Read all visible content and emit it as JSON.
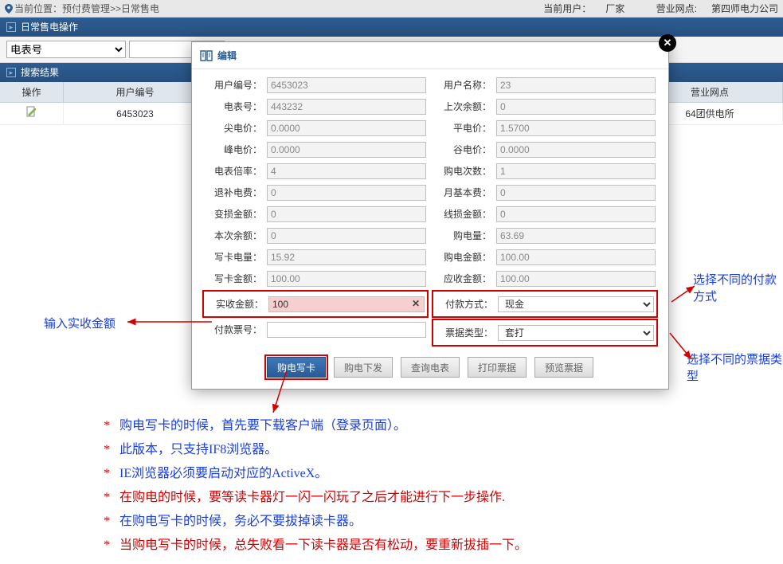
{
  "topbar": {
    "loc_prefix": "当前位置：",
    "loc_path": "预付费管理>>日常售电",
    "user_label": "当前用户：",
    "user_value": "厂家",
    "branch_label": "营业网点:",
    "branch_value": "第四师电力公司"
  },
  "panel1_title": "日常售电操作",
  "filter": {
    "selected": "电表号"
  },
  "panel2_title": "搜索结果",
  "table": {
    "headers": {
      "op": "操作",
      "uid": "用户编号",
      "branch": "营业网点"
    },
    "row": {
      "uid": "6453023",
      "branch": "64团供电所"
    }
  },
  "dialog": {
    "title": "编辑",
    "left": {
      "user_no_l": "用户编号：",
      "user_no": "6453023",
      "meter_no_l": "电表号：",
      "meter_no": "443232",
      "peak_l": "尖电价：",
      "peak": "0.0000",
      "high_l": "峰电价：",
      "high": "0.0000",
      "mult_l": "电表倍率：",
      "mult": "4",
      "refund_l": "退补电费：",
      "refund": "0",
      "loss_l": "变损金额：",
      "loss": "0",
      "bal_l": "本次余额：",
      "bal": "0",
      "wqty_l": "写卡电量：",
      "wqty": "15.92",
      "wamt_l": "写卡金额：",
      "wamt": "100.00",
      "actual_l": "实收金额：",
      "actual": "100",
      "ticket_l": "付款票号："
    },
    "right": {
      "uname_l": "用户名称：",
      "uname": "23",
      "lastbal_l": "上次余额：",
      "lastbal": "0",
      "flat_l": "平电价：",
      "flat": "1.5700",
      "valley_l": "谷电价：",
      "valley": "0.0000",
      "count_l": "购电次数：",
      "count": "1",
      "monthly_l": "月基本费：",
      "monthly": "0",
      "lineloss_l": "线损金额：",
      "lineloss": "0",
      "buyqty_l": "购电量：",
      "buyqty": "63.69",
      "buyamt_l": "购电金额：",
      "buyamt": "100.00",
      "due_l": "应收金额：",
      "due": "100.00",
      "paym_l": "付款方式：",
      "paym": "现金",
      "rtype_l": "票据类型：",
      "rtype": "套打"
    },
    "buttons": {
      "b1": "购电写卡",
      "b2": "购电下发",
      "b3": "查询电表",
      "b4": "打印票据",
      "b5": "预览票据"
    }
  },
  "annots": {
    "left": "输入实收金额",
    "right1": "选择不同的付款方式",
    "right2": "选择不同的票据类型"
  },
  "notes": [
    {
      "c": "blue",
      "t": "购电写卡的时候，首先要下载客户端（登录页面）。"
    },
    {
      "c": "blue",
      "t": "此版本，只支持IF8浏览器。"
    },
    {
      "c": "blue",
      "t": "IE浏览器必须要启动对应的ActiveX。"
    },
    {
      "c": "red",
      "t": "在购电的时候，要等读卡器灯一闪一闪玩了之后才能进行下一步操作."
    },
    {
      "c": "blue",
      "t": "在购电写卡的时候，务必不要拔掉读卡器。"
    },
    {
      "c": "red",
      "t": "当购电写卡的时候，总失败看一下读卡器是否有松动，要重新拔插一下。"
    }
  ]
}
